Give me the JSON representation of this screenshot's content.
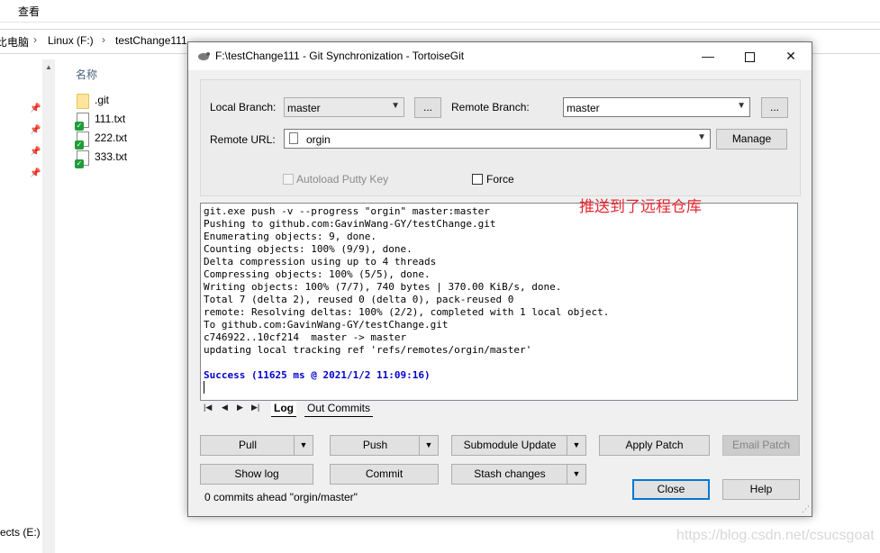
{
  "explorer": {
    "menu_view": "查看",
    "breadcrumb": [
      "比电脑",
      "Linux (F:)",
      "testChange111"
    ],
    "column_name": "名称",
    "files": [
      ".git",
      "111.txt",
      "222.txt",
      "333.txt"
    ],
    "drive_label": "ects (E:)"
  },
  "dialog": {
    "title": "F:\\testChange111 - Git Synchronization - TortoiseGit",
    "local_branch_label": "Local Branch:",
    "local_branch_value": "master",
    "browse_label": "...",
    "remote_branch_label": "Remote Branch:",
    "remote_branch_value": "master",
    "remote_url_label": "Remote URL:",
    "remote_url_value": "orgin",
    "manage_label": "Manage",
    "autoload_label": "Autoload Putty Key",
    "force_label": "Force",
    "log_lines": [
      "git.exe push -v --progress \"orgin\" master:master",
      "Pushing to github.com:GavinWang-GY/testChange.git",
      "Enumerating objects: 9, done.",
      "Counting objects: 100% (9/9), done.",
      "Delta compression using up to 4 threads",
      "Compressing objects: 100% (5/5), done.",
      "Writing objects: 100% (7/7), 740 bytes | 370.00 KiB/s, done.",
      "Total 7 (delta 2), reused 0 (delta 0), pack-reused 0",
      "remote: Resolving deltas: 100% (2/2), completed with 1 local object.",
      "To github.com:GavinWang-GY/testChange.git",
      "c746922..10cf214  master -> master",
      "updating local tracking ref 'refs/remotes/orgin/master'"
    ],
    "success_line": "Success (11625 ms @ 2021/1/2 11:09:16)",
    "annotation": "推送到了远程仓库",
    "tabs": [
      "Log",
      "Out Commits"
    ],
    "buttons": {
      "pull": "Pull",
      "push": "Push",
      "submodule_update": "Submodule Update",
      "apply_patch": "Apply Patch",
      "email_patch": "Email Patch",
      "show_log": "Show log",
      "commit": "Commit",
      "stash_changes": "Stash changes",
      "close": "Close",
      "help": "Help"
    },
    "status": "0 commits ahead \"orgin/master\""
  },
  "watermark": "https://blog.csdn.net/csucsgoat",
  "colors": {
    "annotation": "#e8262f",
    "success": "#0000d0",
    "default_button_border": "#0078d7"
  }
}
